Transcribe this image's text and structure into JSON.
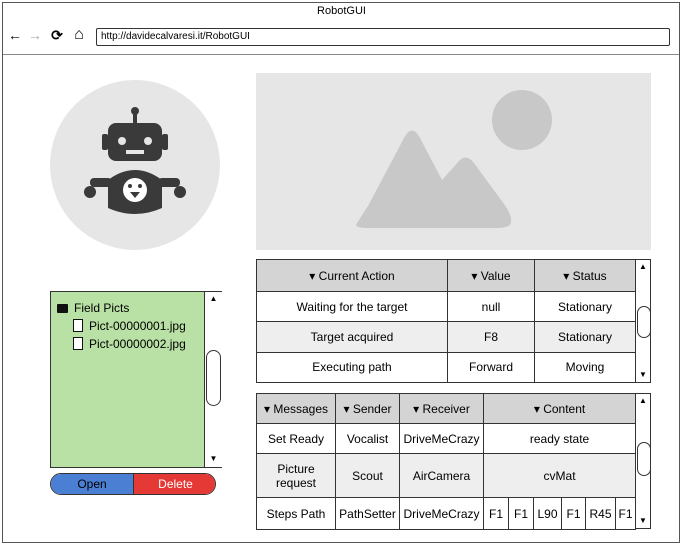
{
  "window": {
    "title": "RobotGUI"
  },
  "nav": {
    "back_icon": "←",
    "forward_icon": "→",
    "reload_icon": "⟳",
    "home_icon": "⌂",
    "url": "http://davidecalvaresi.it/RobotGUI"
  },
  "file_tree": {
    "folder": "Field Picts",
    "files": [
      "Pict-00000001.jpg",
      "Pict-00000002.jpg"
    ]
  },
  "buttons": {
    "open": "Open",
    "delete": "Delete"
  },
  "actions_table": {
    "headers": [
      "▾ Current Action",
      "▾ Value",
      "▾ Status"
    ],
    "rows": [
      [
        "Waiting for the target",
        "null",
        "Stationary"
      ],
      [
        "Target acquired",
        "F8",
        "Stationary"
      ],
      [
        "Executing path",
        "Forward",
        "Moving"
      ]
    ]
  },
  "messages_table": {
    "headers": [
      "▾ Messages",
      "▾ Sender",
      "▾ Receiver",
      "▾ Content"
    ],
    "rows": [
      {
        "message": "Set Ready",
        "sender": "Vocalist",
        "receiver": "DriveMeCrazy",
        "content": "ready state"
      },
      {
        "message": "Picture request",
        "sender": "Scout",
        "receiver": "AirCamera",
        "content": "cvMat"
      }
    ],
    "steps_row": {
      "message": "Steps Path",
      "sender": "PathSetter",
      "receiver": "DriveMeCrazy",
      "steps": [
        "F1",
        "F1",
        "L90",
        "F1",
        "R45",
        "F1"
      ]
    }
  },
  "colors": {
    "tree_bg": "#b9e0a5",
    "open_btn": "#4a7fd4",
    "delete_btn": "#e53935",
    "placeholder": "#e6e6e6"
  },
  "icons": {
    "scroll_up": "▲",
    "scroll_down": "▼"
  }
}
